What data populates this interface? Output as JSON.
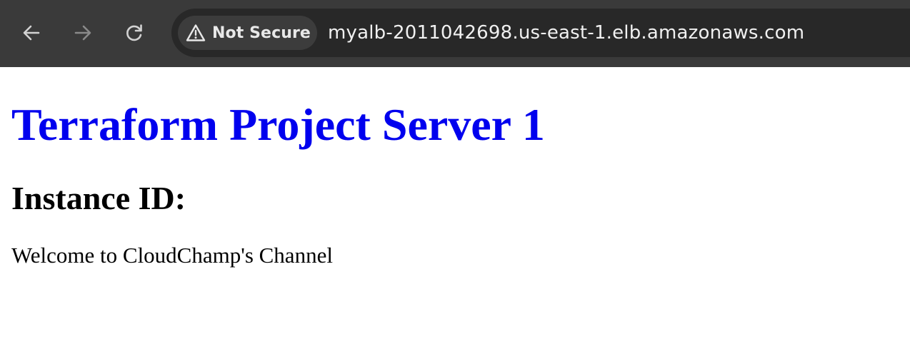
{
  "browser": {
    "security_label": "Not Secure",
    "url": "myalb-2011042698.us-east-1.elb.amazonaws.com",
    "icons": {
      "back": "arrow-left-icon",
      "forward": "arrow-right-icon",
      "reload": "reload-icon",
      "security": "warning-triangle-icon"
    },
    "forward_enabled": false
  },
  "page": {
    "title": "Terraform Project Server 1",
    "subtitle": "Instance ID:",
    "body_text": "Welcome to CloudChamp's Channel"
  },
  "colors": {
    "toolbar_bg": "#3a3a3a",
    "omnibox_bg": "#282828",
    "title_color": "#0000ee",
    "text_color": "#000000",
    "page_bg": "#ffffff"
  }
}
